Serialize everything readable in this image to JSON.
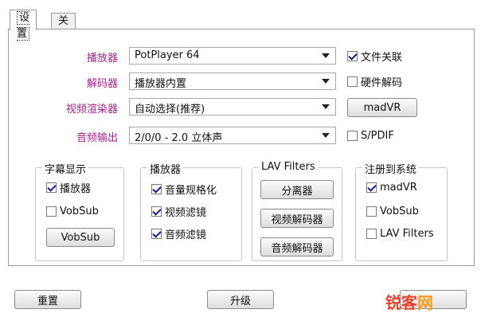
{
  "tabs": [
    "设置",
    "关于"
  ],
  "rows": [
    {
      "label": "播放器",
      "value": "PotPlayer 64"
    },
    {
      "label": "解码器",
      "value": "播放器内置"
    },
    {
      "label": "视频渲染器",
      "value": "自动选择(推荐)"
    },
    {
      "label": "音频输出",
      "value": "2/0/0 - 2.0 立体声"
    }
  ],
  "side": {
    "file_assoc": {
      "label": "文件关联",
      "checked": true
    },
    "hw_decode": {
      "label": "硬件解码",
      "checked": false
    },
    "madvr_button": "madVR",
    "spdif": {
      "label": "S/PDIF",
      "checked": false
    }
  },
  "groups": {
    "subtitle": {
      "title": "字幕显示",
      "items": [
        {
          "label": "播放器",
          "checked": true
        },
        {
          "label": "VobSub",
          "checked": false
        }
      ],
      "button": "VobSub"
    },
    "player": {
      "title": "播放器",
      "items": [
        {
          "label": "音量规格化",
          "checked": true
        },
        {
          "label": "视频滤镜",
          "checked": true
        },
        {
          "label": "音频滤镜",
          "checked": true
        }
      ]
    },
    "lav": {
      "title": "LAV Filters",
      "buttons": [
        "分离器",
        "视频解码器",
        "音频解码器"
      ]
    },
    "register": {
      "title": "注册到系统",
      "items": [
        {
          "label": "madVR",
          "checked": true
        },
        {
          "label": "VobSub",
          "checked": false
        },
        {
          "label": "LAV Filters",
          "checked": false
        }
      ]
    }
  },
  "bottom": {
    "reset": "重置",
    "upgrade": "升级"
  },
  "watermark": {
    "part1": "锐客",
    "part2": "网"
  },
  "colors": {
    "label": "#a0208a",
    "watermark_red": "#e8432e",
    "watermark_orange": "#f29a1e"
  }
}
